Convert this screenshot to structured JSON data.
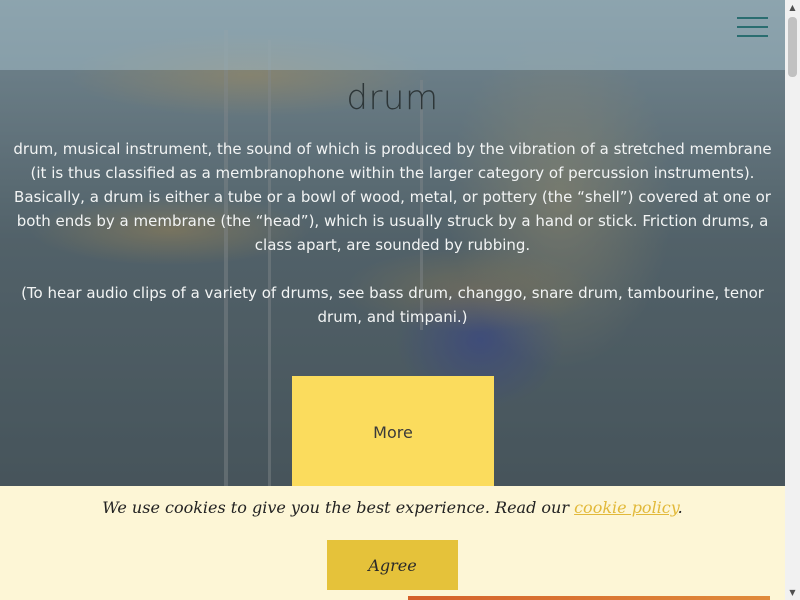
{
  "header": {
    "menu_icon": "hamburger-menu-icon",
    "accent_color": "#2a6d70"
  },
  "hero": {
    "title": "drum",
    "paragraph_1": "drum, musical instrument, the sound of which is produced by the vibration of a stretched membrane (it is thus classified as a membranophone within the larger category of percussion instruments). Basically, a drum is either a tube or a bowl of wood, metal, or pottery (the “shell”) covered at one or both ends by a membrane (the “head”), which is usually struck by a hand or stick. Friction drums, a class apart, are sounded by rubbing.",
    "paragraph_2": "(To hear audio clips of a variety of drums, see bass drum, changgo, snare drum, tambourine, tenor drum, and timpani.)",
    "more_label": "More",
    "more_color": "#fbdc5d"
  },
  "cookie": {
    "text_before": "We use cookies to give you the best experience. Read our ",
    "link_text": "cookie policy",
    "text_after": ".",
    "agree_label": "Agree",
    "background_color": "#fdf6d6",
    "button_color": "#e5c23a"
  },
  "scrollbar": {
    "up_icon": "scroll-up-arrow-icon",
    "down_icon": "scroll-down-arrow-icon"
  }
}
